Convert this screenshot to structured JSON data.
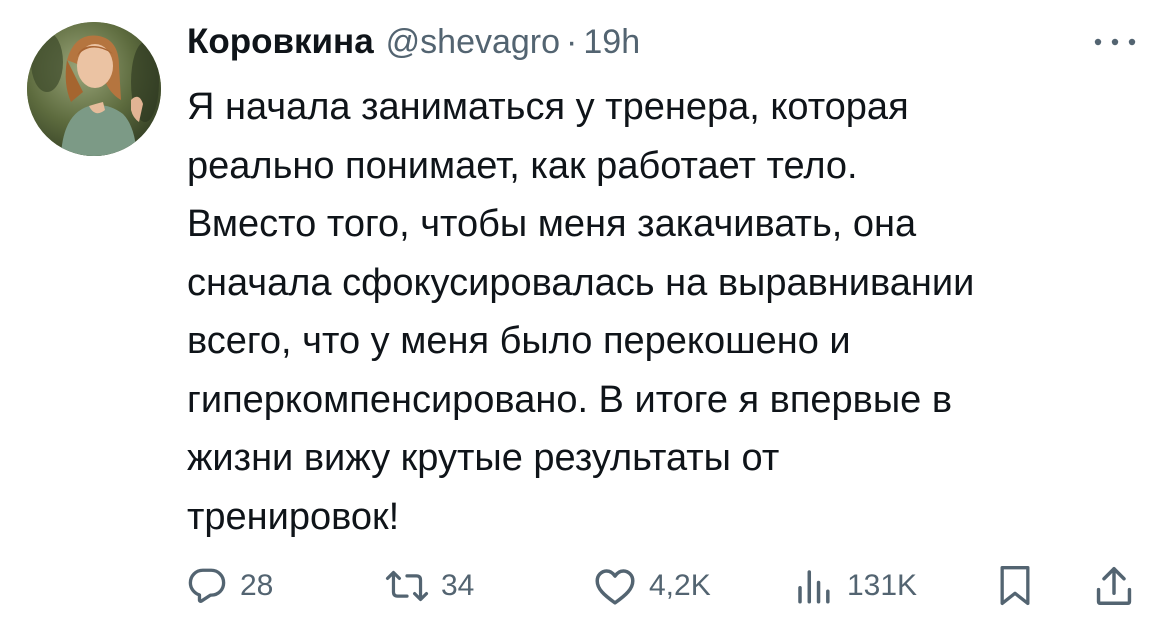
{
  "author": {
    "display_name": "Коровкина",
    "handle": "@shevagro",
    "separator": "·",
    "time": "19h",
    "avatar_icon": "profile-photo"
  },
  "tweet": {
    "lines": [
      "Я начала заниматься у тренера, которая",
      "реально понимает, как работает тело.",
      "Вместо того, чтобы меня закачивать, она",
      "сначала сфокусировалась на выравнивании",
      "всего, что у меня было перекошено и",
      "гиперкомпенсировано. В итоге я впервые в",
      "жизни вижу крутые результаты от",
      "тренировок!"
    ]
  },
  "actions": {
    "replies": "28",
    "retweets": "34",
    "likes": "4,2K",
    "views": "131K",
    "icons": {
      "reply": "reply-icon",
      "retweet": "retweet-icon",
      "like": "heart-icon",
      "views": "views-icon",
      "bookmark": "bookmark-icon",
      "share": "share-icon",
      "more": "more-icon"
    }
  },
  "colors": {
    "text": "#0f1419",
    "secondary": "#536471",
    "background": "#ffffff"
  }
}
